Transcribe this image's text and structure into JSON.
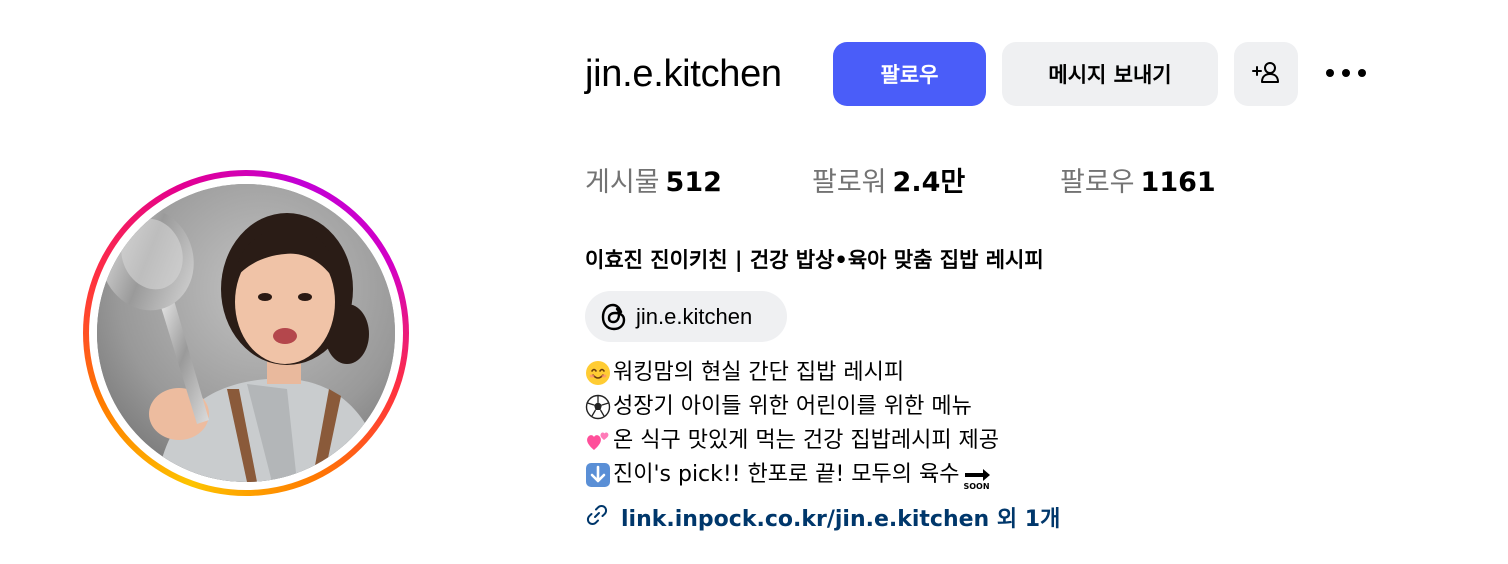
{
  "profile": {
    "username": "jin.e.kitchen",
    "follow_label": "팔로우",
    "message_label": "메시지 보내기",
    "add_user_icon": "add-user-icon",
    "more_icon": "more-options-icon"
  },
  "stats": {
    "posts_label": "게시물",
    "posts_value": "512",
    "followers_label": "팔로워",
    "followers_value": "2.4만",
    "following_label": "팔로우",
    "following_value": "1161"
  },
  "bio": {
    "full_name": "이효진 진이키친 | 건강 밥상•육아 맞춤 집밥 레시피",
    "threads_handle": "jin.e.kitchen",
    "lines": [
      "워킹맘의 현실 간단 집밥 레시피",
      "성장기 아이들 위한 어린이를 위한 메뉴",
      "온 식구 맛있게 먹는 건강 집밥레시피 제공",
      " 진이's pick!! 한포로 끝! 모두의 육수"
    ],
    "line_icons": [
      "smiling-face-emoji",
      "soccer-ball-emoji",
      "two-hearts-emoji",
      "down-arrow-emoji"
    ],
    "soon_badge": "SOON",
    "link_text": "link.inpock.co.kr/jin.e.kitchen 외 1개"
  },
  "colors": {
    "follow_button": "#4a5df9",
    "secondary_button": "#eff0f2",
    "link": "#00376b",
    "muted_text": "#737373"
  }
}
